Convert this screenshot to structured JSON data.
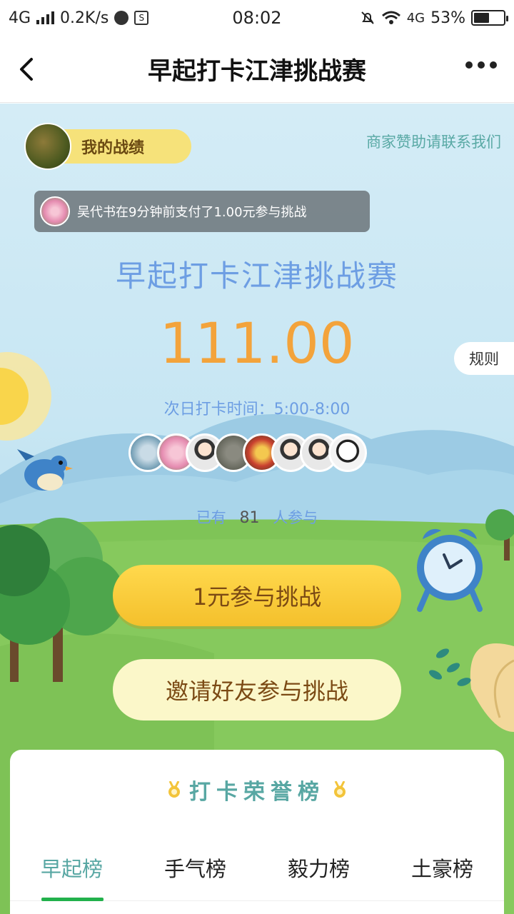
{
  "status_bar": {
    "network": "4G",
    "speed": "0.2K/s",
    "time": "08:02",
    "network_right": "4G",
    "battery": "53%",
    "battery_level": 0.53
  },
  "nav": {
    "title": "早起打卡江津挑战赛",
    "back_icon": "chevron-left-icon",
    "more_icon": "more-dots-icon"
  },
  "hero": {
    "my_record": "我的战绩",
    "sponsor_link": "商家赞助请联系我们",
    "ticker": "吴代书在9分钟前支付了1.00元参与挑战",
    "contest_title": "早起打卡江津挑战赛",
    "prize_pool": "111.00",
    "rules": "规则",
    "checkin_time": "次日打卡时间：5:00-8:00",
    "participants_prefix": "已有",
    "participants_count": "81",
    "participants_suffix": "人参与",
    "participant_avatars": 8
  },
  "actions": {
    "join": "1元参与挑战",
    "invite": "邀请好友参与挑战"
  },
  "honor": {
    "title": "打卡荣誉榜",
    "tabs": [
      {
        "label": "早起榜",
        "active": true
      },
      {
        "label": "手气榜",
        "active": false
      },
      {
        "label": "毅力榜",
        "active": false
      },
      {
        "label": "土豪榜",
        "active": false
      }
    ]
  },
  "colors": {
    "accent": "#58a7a3",
    "title_blue": "#6d9ee3",
    "prize_orange": "#f3a33b",
    "join_yellow": "#f8cc3a",
    "tab_underline": "#22b14c"
  }
}
